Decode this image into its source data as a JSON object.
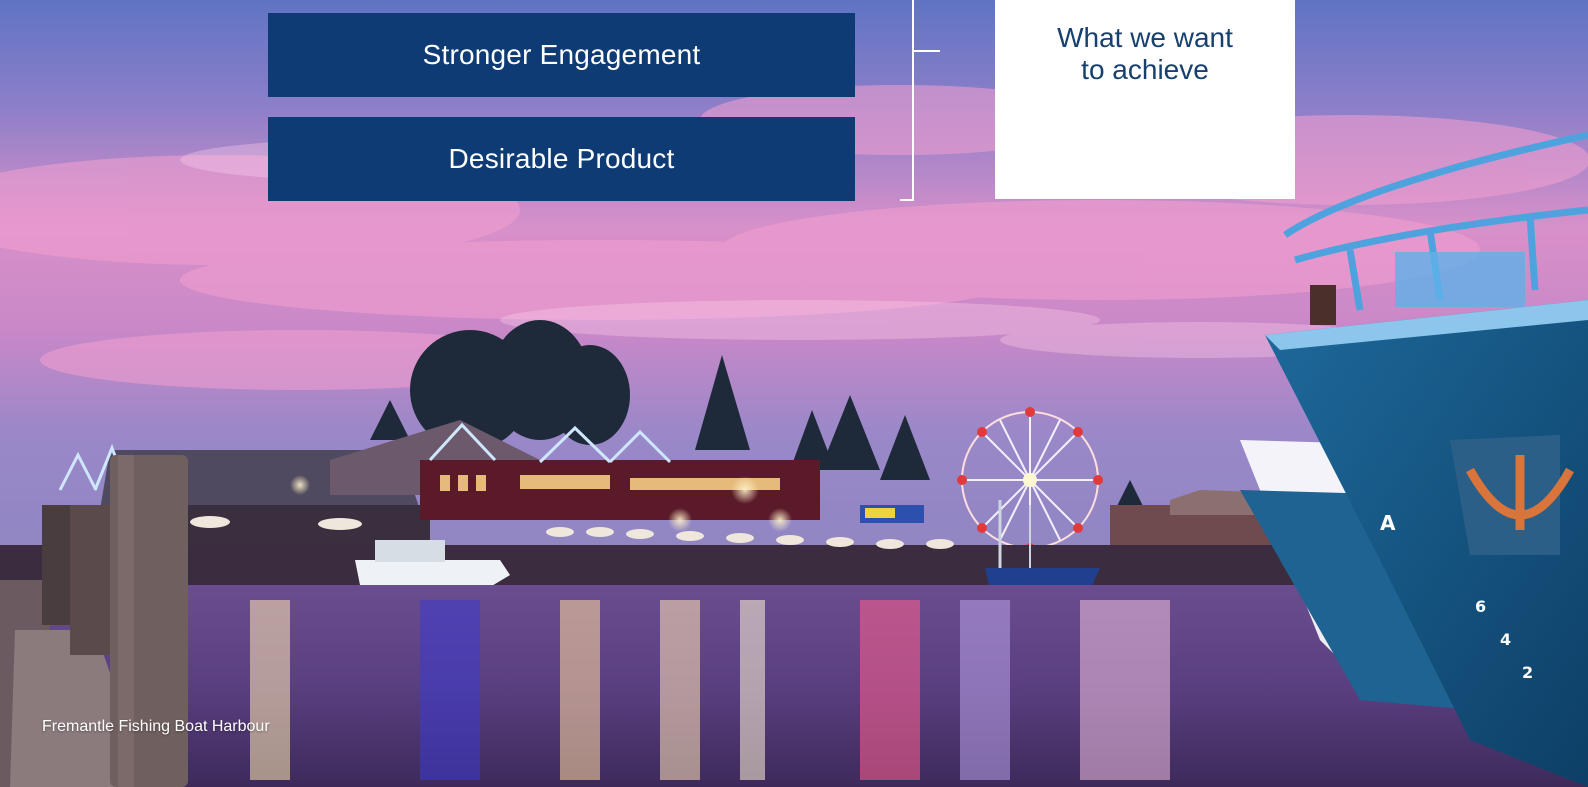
{
  "colors": {
    "box_navy": "#0e3b73",
    "achieve_text": "#17406f",
    "bracket": "#ffffff"
  },
  "goals": [
    {
      "label": "Stronger Engagement"
    },
    {
      "label": "Desirable Product"
    }
  ],
  "achieve_card": {
    "text": "What we want\nto achieve"
  },
  "photo": {
    "caption": "Fremantle Fishing Boat Harbour"
  }
}
